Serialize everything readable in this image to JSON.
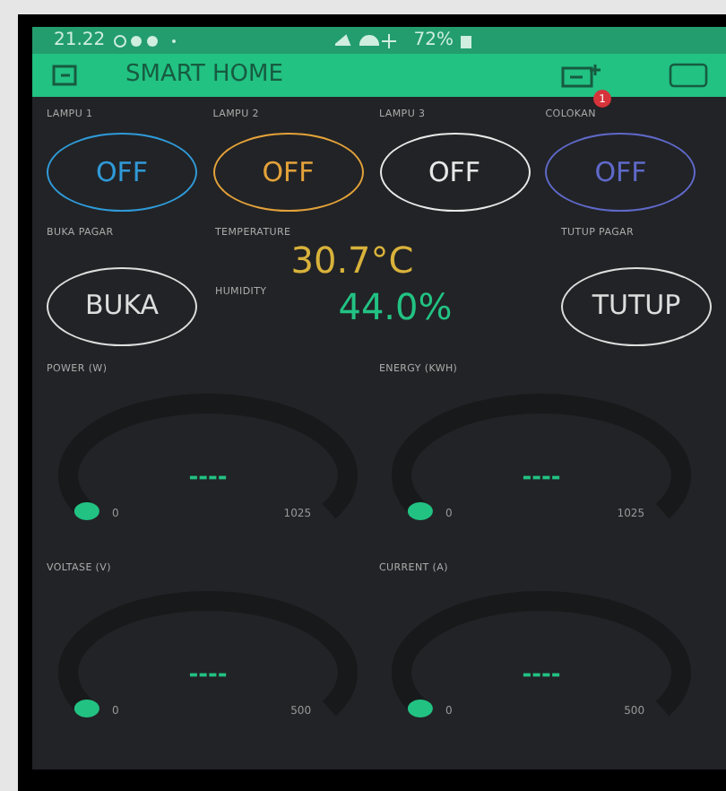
{
  "status_bar": {
    "time": "21.22",
    "battery": "72%"
  },
  "app_bar": {
    "title": "SMART HOME",
    "notification_count": "1"
  },
  "switches": [
    {
      "label": "LAMPU 1",
      "text": "OFF",
      "color": "#2f9ad8"
    },
    {
      "label": "LAMPU 2",
      "text": "OFF",
      "color": "#e3a23a"
    },
    {
      "label": "LAMPU 3",
      "text": "OFF",
      "color": "#e8e8e8"
    },
    {
      "label": "COLOKAN",
      "text": "OFF",
      "color": "#5f69c9"
    }
  ],
  "gate_open": {
    "label": "BUKA PAGAR",
    "text": "BUKA"
  },
  "temperature": {
    "label": "TEMPERATURE",
    "value": "30.7°C"
  },
  "humidity": {
    "label": "HUMIDITY",
    "value": "44.0%"
  },
  "gate_close": {
    "label": "TUTUP PAGAR",
    "text": "TUTUP"
  },
  "gauges": [
    {
      "label": "POWER (W)",
      "value": "----",
      "min": "0",
      "max": "1025"
    },
    {
      "label": "ENERGY (KWH)",
      "value": "----",
      "min": "0",
      "max": "1025"
    },
    {
      "label": "VOLTASE (V)",
      "value": "----",
      "min": "0",
      "max": "500"
    },
    {
      "label": "CURRENT (A)",
      "value": "----",
      "min": "0",
      "max": "500"
    }
  ]
}
